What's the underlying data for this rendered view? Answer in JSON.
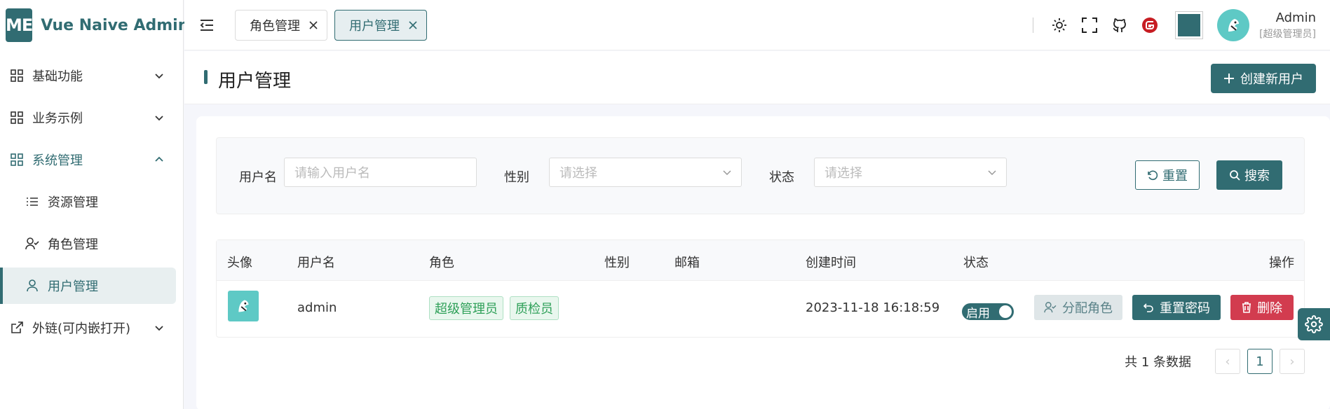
{
  "app": {
    "logo_mark": "ME",
    "title": "Vue Naive Admin"
  },
  "sidebar": {
    "items": [
      {
        "label": "基础功能",
        "icon": "grid-icon"
      },
      {
        "label": "业务示例",
        "icon": "grid-icon"
      },
      {
        "label": "系统管理",
        "icon": "grid-icon",
        "expanded": true
      },
      {
        "label": "资源管理",
        "icon": "list-icon"
      },
      {
        "label": "角色管理",
        "icon": "user-check-icon"
      },
      {
        "label": "用户管理",
        "icon": "user-icon",
        "selected": true
      },
      {
        "label": "外链(可内嵌打开)",
        "icon": "external-link-icon"
      }
    ]
  },
  "tabs": [
    {
      "label": "角色管理"
    },
    {
      "label": "用户管理",
      "active": true
    }
  ],
  "user": {
    "name": "Admin",
    "role": "[超级管理员]"
  },
  "theme": {
    "accent": "#316c72",
    "danger": "#d23c4f",
    "success": "#2fa059"
  },
  "page": {
    "title": "用户管理",
    "create_button": "创建新用户"
  },
  "filters": {
    "username_label": "用户名",
    "username_placeholder": "请输入用户名",
    "gender_label": "性别",
    "gender_placeholder": "请选择",
    "status_label": "状态",
    "status_placeholder": "请选择",
    "reset_button": "重置",
    "search_button": "搜索"
  },
  "table": {
    "headers": [
      "头像",
      "用户名",
      "角色",
      "性别",
      "邮箱",
      "创建时间",
      "状态",
      "操作"
    ],
    "rows": [
      {
        "username": "admin",
        "roles": [
          "超级管理员",
          "质检员"
        ],
        "gender": "",
        "email": "",
        "created": "2023-11-18 16:18:59",
        "status": "启用",
        "actions": {
          "assign": "分配角色",
          "reset_pwd": "重置密码",
          "delete": "删除"
        }
      }
    ]
  },
  "pagination": {
    "total_text": "共 1 条数据",
    "current_page": "1",
    "prev": "‹",
    "next": "›"
  }
}
